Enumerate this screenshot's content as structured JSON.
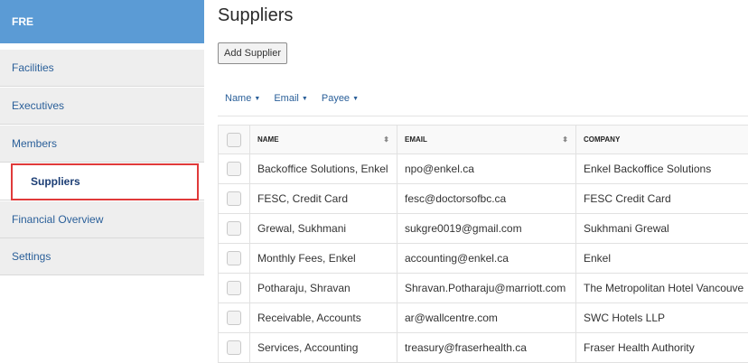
{
  "sidebar": {
    "brand": "FRE",
    "items": [
      {
        "label": "Facilities"
      },
      {
        "label": "Executives"
      },
      {
        "label": "Members"
      },
      {
        "label": "Suppliers"
      },
      {
        "label": "Financial Overview"
      },
      {
        "label": "Settings"
      }
    ],
    "active_item": "Suppliers"
  },
  "main": {
    "title": "Suppliers",
    "add_button": "Add Supplier",
    "filters": [
      {
        "label": "Name"
      },
      {
        "label": "Email"
      },
      {
        "label": "Payee"
      }
    ]
  },
  "table": {
    "columns": [
      {
        "label": "NAME",
        "sortable": true
      },
      {
        "label": "EMAIL",
        "sortable": true
      },
      {
        "label": "COMPANY",
        "sortable": false
      }
    ],
    "rows": [
      {
        "name": "Backoffice Solutions, Enkel",
        "email": "npo@enkel.ca",
        "company": "Enkel Backoffice Solutions"
      },
      {
        "name": "FESC, Credit Card",
        "email": "fesc@doctorsofbc.ca",
        "company": "FESC Credit Card"
      },
      {
        "name": "Grewal, Sukhmani",
        "email": "sukgre0019@gmail.com",
        "company": "Sukhmani Grewal"
      },
      {
        "name": "Monthly Fees, Enkel",
        "email": "accounting@enkel.ca",
        "company": "Enkel"
      },
      {
        "name": "Potharaju, Shravan",
        "email": "Shravan.Potharaju@marriott.com",
        "company": "The Metropolitan Hotel Vancouve"
      },
      {
        "name": "Receivable, Accounts",
        "email": "ar@wallcentre.com",
        "company": "SWC Hotels LLP"
      },
      {
        "name": "Services, Accounting",
        "email": "treasury@fraserhealth.ca",
        "company": "Fraser Health Authority"
      }
    ]
  },
  "colors": {
    "brand_bg": "#5b9bd5",
    "nav_bg": "#eeeeee",
    "link": "#2a5f99",
    "highlight_outline": "#e03a3a"
  },
  "icons": {
    "sort": "sort-icon",
    "filter_caret": "caret-down-icon"
  }
}
